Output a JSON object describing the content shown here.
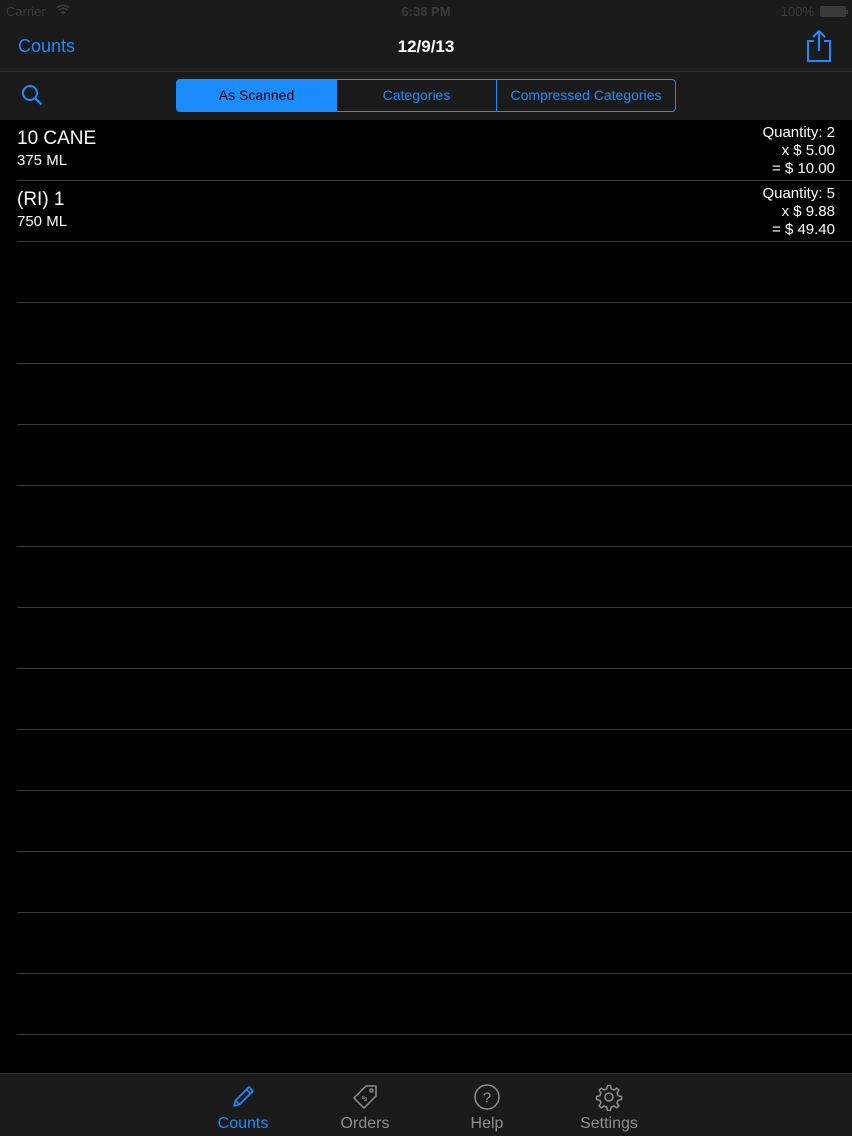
{
  "status": {
    "carrier": "Carrier",
    "time": "6:38 PM",
    "battery": "100%"
  },
  "nav": {
    "back_label": "Counts",
    "title": "12/9/13"
  },
  "segments": [
    "As Scanned",
    "Categories",
    "Compressed Categories"
  ],
  "selected_segment": "As Scanned",
  "items": [
    {
      "name": "10 CANE",
      "size": "375 ML",
      "quantity": "Quantity: 2",
      "price": "x $ 5.00",
      "total": "= $ 10.00"
    },
    {
      "name": "(RI) 1",
      "size": "750 ML",
      "quantity": "Quantity: 5",
      "price": "x $ 9.88",
      "total": "= $ 49.40"
    }
  ],
  "tabs": [
    {
      "label": "Counts",
      "icon": "pencil-icon",
      "active": true
    },
    {
      "label": "Orders",
      "icon": "tag-icon",
      "active": false
    },
    {
      "label": "Help",
      "icon": "question-icon",
      "active": false
    },
    {
      "label": "Settings",
      "icon": "gear-icon",
      "active": false
    }
  ],
  "colors": {
    "accent": "#1b8cff",
    "bar": "#1a1a1a",
    "background": "#000000",
    "inactive_tab": "#8e8e8e"
  }
}
